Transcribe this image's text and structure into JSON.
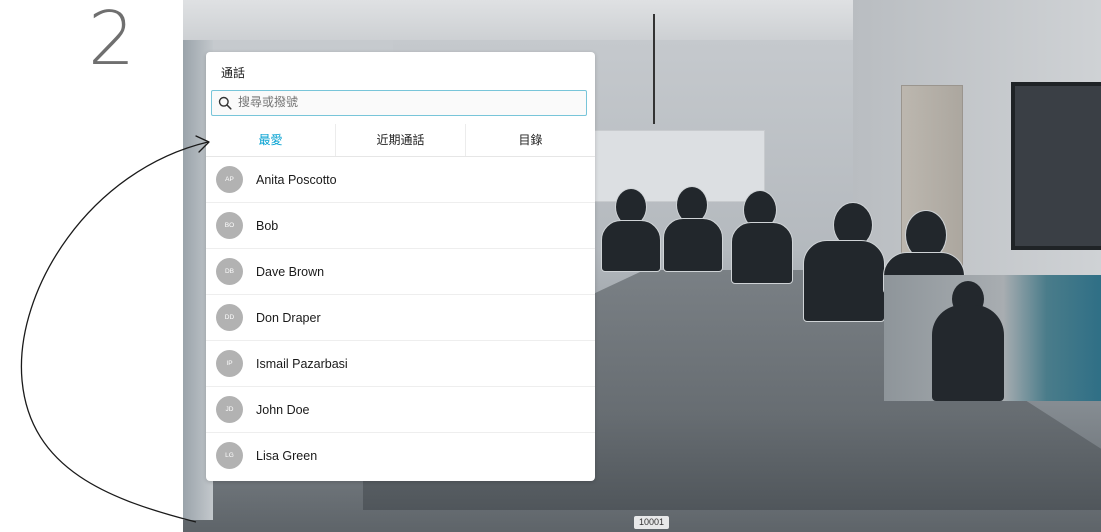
{
  "step": "2",
  "panel": {
    "title": "通話",
    "search_placeholder": "搜尋或撥號",
    "tabs": [
      {
        "label": "最愛",
        "active": true
      },
      {
        "label": "近期通話",
        "active": false
      },
      {
        "label": "目錄",
        "active": false
      }
    ],
    "contacts": [
      {
        "initials": "AP",
        "name": "Anita Poscotto"
      },
      {
        "initials": "BO",
        "name": "Bob"
      },
      {
        "initials": "DB",
        "name": "Dave Brown"
      },
      {
        "initials": "DD",
        "name": "Don Draper"
      },
      {
        "initials": "IP",
        "name": "Ismail Pazarbasi"
      },
      {
        "initials": "JD",
        "name": "John Doe"
      },
      {
        "initials": "LG",
        "name": "Lisa Green"
      }
    ]
  },
  "call_id": "10001",
  "colors": {
    "accent": "#00a0d1",
    "search_border": "#78c5d9",
    "avatar_bg": "#b2b2b2"
  },
  "icons": [
    "search-icon",
    "arrow-icon"
  ]
}
